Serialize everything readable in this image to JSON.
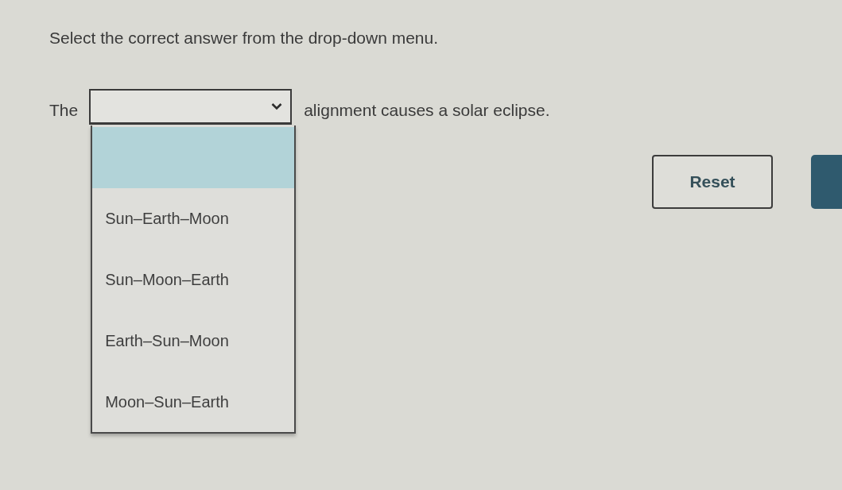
{
  "instruction": "Select the correct answer from the drop-down menu.",
  "question": {
    "before": "The",
    "after": "alignment causes a solar eclipse.",
    "dropdown": {
      "expanded": true,
      "blank_option_highlighted": true,
      "options": [
        {
          "label": "Sun–Earth–Moon",
          "selected": false
        },
        {
          "label": "Sun–Moon–Earth",
          "selected": false
        },
        {
          "label": "Earth–Sun–Moon",
          "selected": false
        },
        {
          "label": "Moon–Sun–Earth",
          "selected": false
        }
      ]
    }
  },
  "buttons": [
    {
      "kind": "outline",
      "label": "Reset"
    },
    {
      "kind": "filled"
    }
  ]
}
